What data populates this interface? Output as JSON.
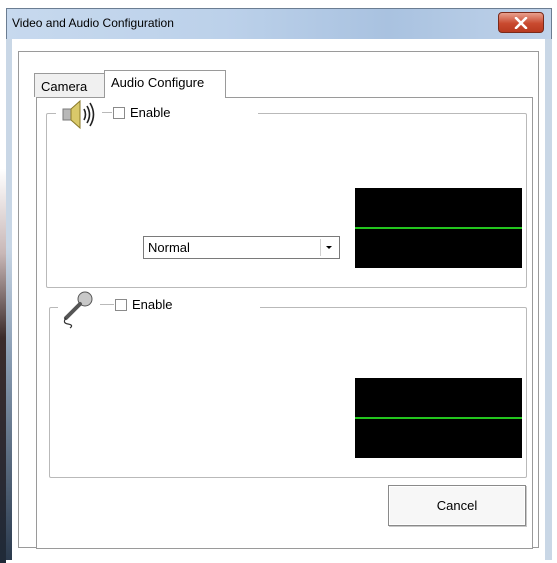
{
  "window": {
    "title": "Video and Audio Configuration",
    "close_icon": "close-icon"
  },
  "tabs": [
    {
      "label": "Camera",
      "selected": false
    },
    {
      "label": "Audio Configure",
      "selected": true
    }
  ],
  "speaker_section": {
    "icon": "speaker-icon",
    "enable_label": "Enable",
    "enabled": false,
    "quality_select": {
      "value": "Normal"
    },
    "meter_color": "#23c51e"
  },
  "microphone_section": {
    "icon": "microphone-icon",
    "enable_label": "Enable",
    "enabled": false,
    "meter_color": "#23c51e"
  },
  "buttons": {
    "cancel_label": "Cancel"
  }
}
